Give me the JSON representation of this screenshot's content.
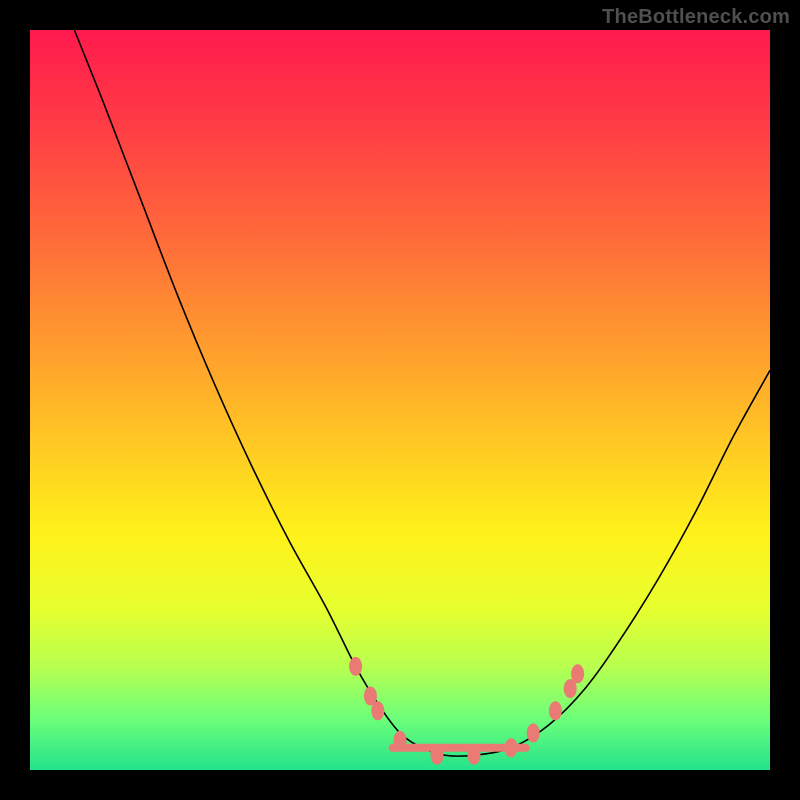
{
  "watermark": "TheBottleneck.com",
  "colors": {
    "gradient_top": "#ff1a4d",
    "gradient_mid": "#fff11a",
    "gradient_bottom": "#24e38a",
    "curve": "#000000",
    "dots": "#e97a74",
    "frame": "#000000"
  },
  "chart_data": {
    "type": "line",
    "title": "",
    "xlabel": "",
    "ylabel": "",
    "xlim": [
      0,
      100
    ],
    "ylim": [
      0,
      100
    ],
    "series": [
      {
        "name": "bottleneck-curve",
        "x": [
          6,
          10,
          15,
          20,
          25,
          30,
          35,
          40,
          44,
          47,
          50,
          53,
          56,
          60,
          65,
          70,
          75,
          80,
          85,
          90,
          95,
          100
        ],
        "y": [
          100,
          90,
          77,
          64,
          52,
          41,
          31,
          22,
          14,
          9,
          5,
          3,
          2,
          2,
          3,
          6,
          11,
          18,
          26,
          35,
          45,
          54
        ]
      }
    ],
    "markers": [
      {
        "x": 44,
        "y": 14
      },
      {
        "x": 46,
        "y": 10
      },
      {
        "x": 47,
        "y": 8
      },
      {
        "x": 50,
        "y": 4
      },
      {
        "x": 55,
        "y": 2
      },
      {
        "x": 60,
        "y": 2
      },
      {
        "x": 65,
        "y": 3
      },
      {
        "x": 68,
        "y": 5
      },
      {
        "x": 71,
        "y": 8
      },
      {
        "x": 73,
        "y": 11
      },
      {
        "x": 74,
        "y": 13
      }
    ],
    "marker_link": [
      {
        "x": 49,
        "y": 3
      },
      {
        "x": 67,
        "y": 3
      }
    ]
  }
}
